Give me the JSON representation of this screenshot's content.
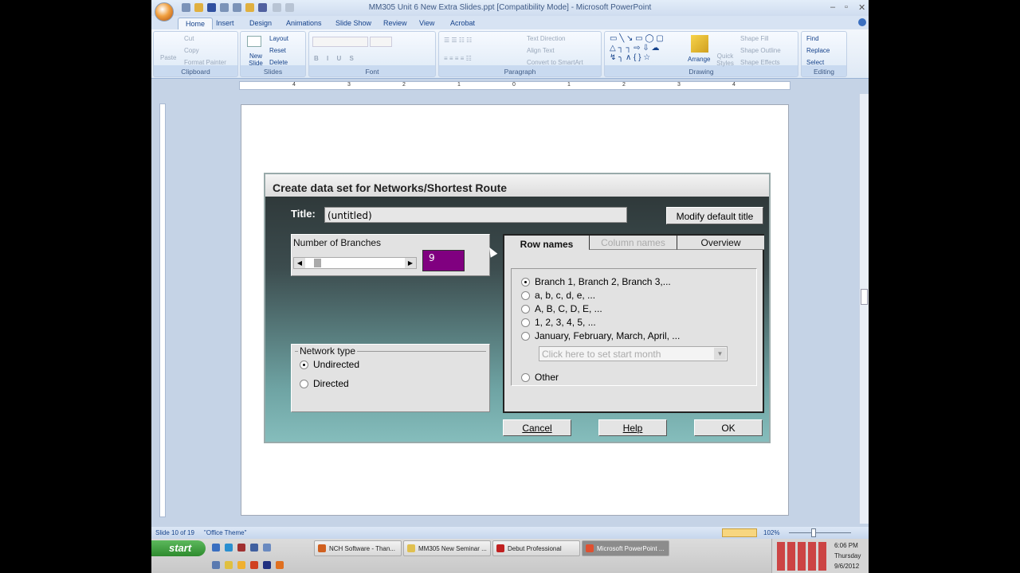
{
  "window": {
    "title": "MM305 Unit 6 New Extra Slides.ppt [Compatibility Mode] - Microsoft PowerPoint"
  },
  "ribbon_tabs": [
    "Home",
    "Insert",
    "Design",
    "Animations",
    "Slide Show",
    "Review",
    "View",
    "Acrobat"
  ],
  "ribbon": {
    "clipboard": {
      "label": "Clipboard",
      "paste": "Paste",
      "cut": "Cut",
      "copy": "Copy",
      "format_painter": "Format Painter"
    },
    "slides": {
      "label": "Slides",
      "new_slide": "New Slide",
      "layout": "Layout",
      "reset": "Reset",
      "delete": "Delete"
    },
    "font": {
      "label": "Font"
    },
    "paragraph": {
      "label": "Paragraph",
      "text_direction": "Text Direction",
      "align_text": "Align Text",
      "convert": "Convert to SmartArt"
    },
    "drawing": {
      "label": "Drawing",
      "arrange": "Arrange",
      "quick_styles": "Quick Styles",
      "shape_fill": "Shape Fill",
      "shape_outline": "Shape Outline",
      "shape_effects": "Shape Effects"
    },
    "editing": {
      "label": "Editing",
      "find": "Find",
      "replace": "Replace",
      "select": "Select"
    }
  },
  "ruler_ticks": [
    "4",
    "3",
    "2",
    "1",
    "0",
    "1",
    "2",
    "3",
    "4"
  ],
  "dialog": {
    "title": "Create data set for Networks/Shortest Route",
    "title_label": "Title:",
    "title_value": "(untitled)",
    "modify_button": "Modify default title",
    "branches_label": "Number of Branches",
    "branches_value": "9",
    "network_type_label": "Network type",
    "network_options": [
      {
        "label": "Undirected",
        "selected": true
      },
      {
        "label": "Directed",
        "selected": false
      }
    ],
    "tabs": [
      "Row names",
      "Column names",
      "Overview"
    ],
    "row_options": [
      {
        "label": "Branch 1, Branch 2, Branch 3,...",
        "selected": true
      },
      {
        "label": "a, b, c, d, e, ...",
        "selected": false
      },
      {
        "label": "A, B, C, D, E, ...",
        "selected": false
      },
      {
        "label": "1, 2, 3, 4, 5, ...",
        "selected": false
      },
      {
        "label": "January, February, March, April, ...",
        "selected": false
      },
      {
        "label": "Other",
        "selected": false
      }
    ],
    "month_placeholder": "Click here to set start month",
    "cancel": "Cancel",
    "help": "Help",
    "ok": "OK"
  },
  "status": {
    "slide": "Slide 10 of 19",
    "theme": "\"Office Theme\"",
    "zoom": "102%"
  },
  "taskbar": {
    "start": "start",
    "items": [
      {
        "label": "NCH Software - Than...",
        "active": false
      },
      {
        "label": "MM305 New Seminar ...",
        "active": false
      },
      {
        "label": "Debut Professional",
        "active": false
      },
      {
        "label": "Microsoft PowerPoint ...",
        "active": true
      }
    ],
    "time": "6:06 PM",
    "day": "Thursday",
    "date": "9/6/2012"
  },
  "colors": {
    "branches_box": "#800080",
    "accent": "#15428b"
  }
}
